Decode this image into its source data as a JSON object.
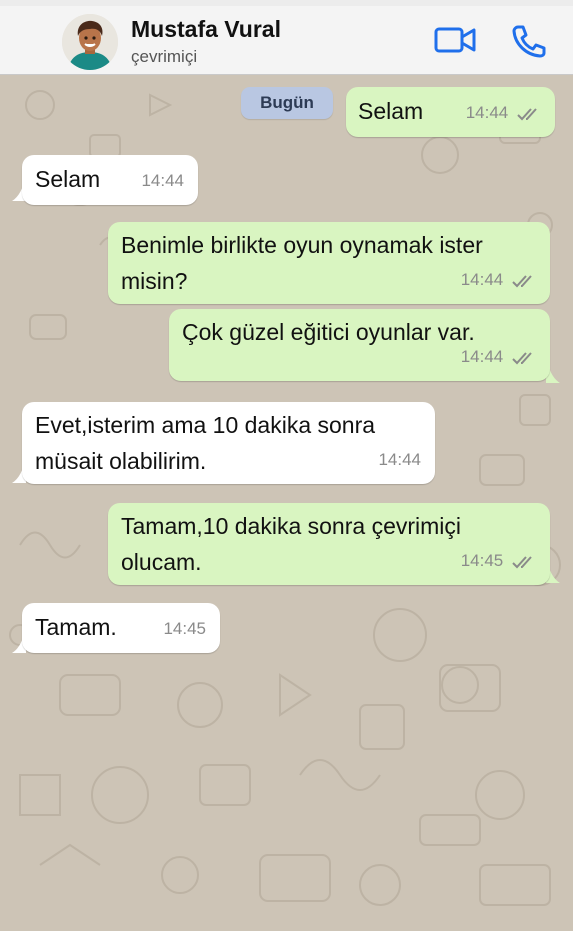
{
  "header": {
    "contact_name": "Mustafa Vural",
    "contact_status": "çevrimiçi",
    "icons": [
      "avatar",
      "video-call-icon",
      "phone-icon"
    ]
  },
  "colors": {
    "header_bg": "#f4f4f4",
    "chat_bg": "#cdc4b6",
    "incoming_bubble": "#ffffff",
    "outgoing_bubble": "#d9f5c1",
    "accent": "#1f6feb",
    "date_chip": "#b9c7e2"
  },
  "chat": {
    "date_label": "Bugün",
    "messages": [
      {
        "direction": "out",
        "text": "Selam",
        "time": "14:44",
        "status": "read"
      },
      {
        "direction": "in",
        "text": "Selam",
        "time": "14:44"
      },
      {
        "direction": "out",
        "text": "Benimle birlikte oyun oynamak ister misin?",
        "time": "14:44",
        "status": "read"
      },
      {
        "direction": "out",
        "text": "Çok güzel eğitici oyunlar var.",
        "time": "14:44",
        "status": "read"
      },
      {
        "direction": "in",
        "text": "Evet,isterim ama 10 dakika sonra müsait olabilirim.",
        "time": "14:44"
      },
      {
        "direction": "out",
        "text": "Tamam,10 dakika sonra çevrimiçi olucam.",
        "time": "14:45",
        "status": "read"
      },
      {
        "direction": "in",
        "text": "Tamam.",
        "time": "14:45"
      }
    ]
  }
}
